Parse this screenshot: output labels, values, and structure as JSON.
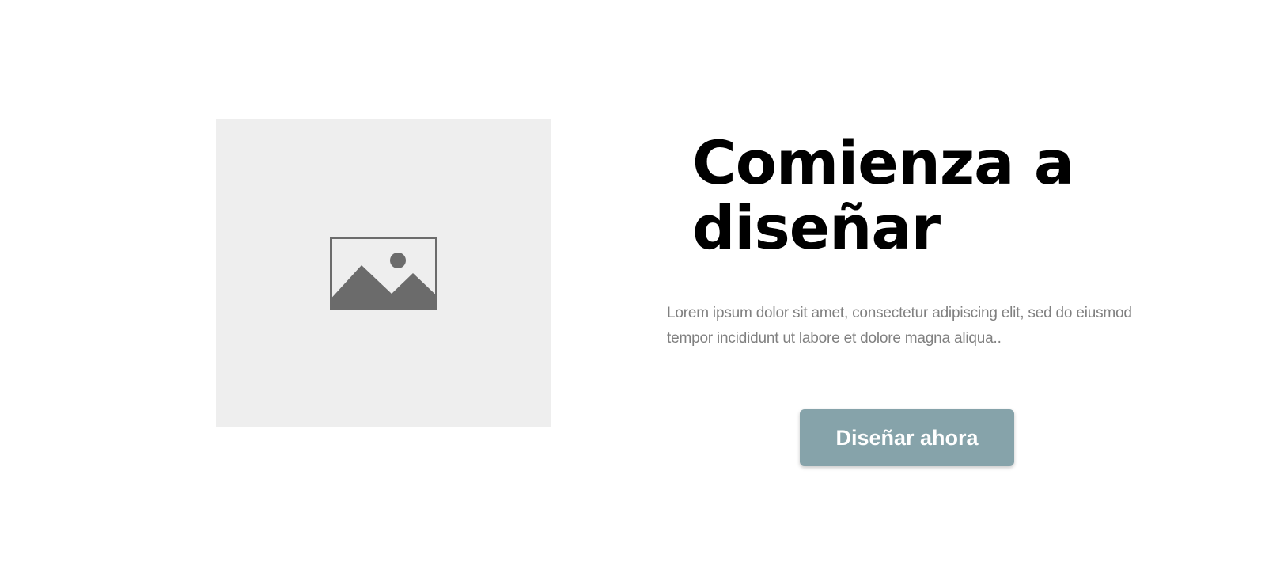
{
  "hero": {
    "image_icon": "image-placeholder-icon",
    "heading": "Comienza a diseñar",
    "body": "Lorem ipsum dolor sit amet, consectetur adipiscing elit, sed do eiusmod tempor incididunt ut labore et dolore magna aliqua..",
    "cta_label": "Diseñar ahora"
  },
  "colors": {
    "placeholder_bg": "#eeeeee",
    "icon": "#6b6b6b",
    "heading": "#000000",
    "body_text": "#808080",
    "button_bg": "#86a3aa",
    "button_text": "#ffffff"
  }
}
